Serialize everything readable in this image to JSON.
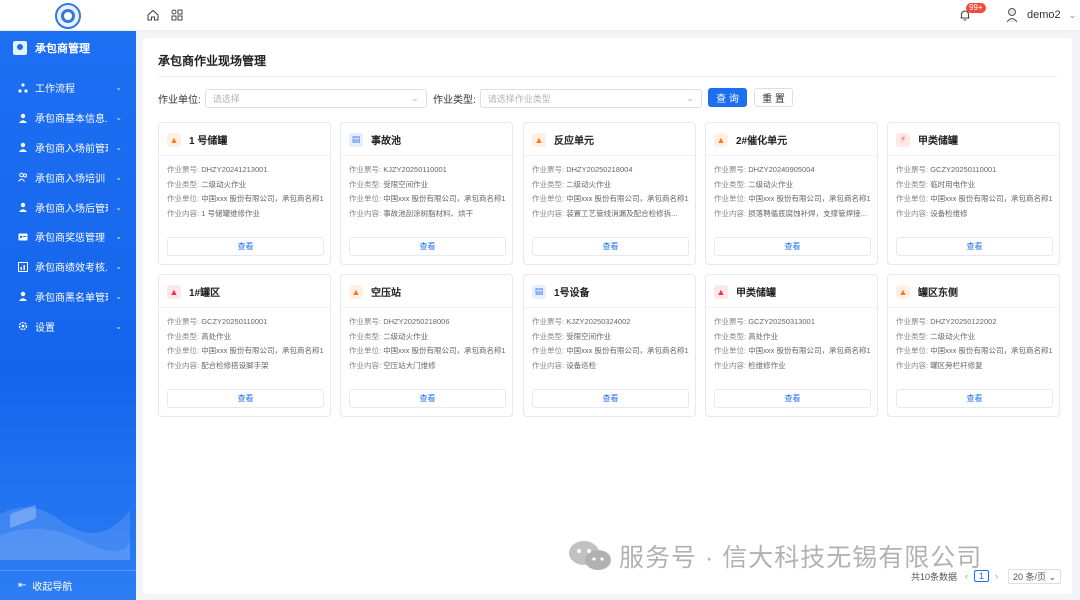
{
  "header": {
    "notification_badge": "99+",
    "user_name": "demo2"
  },
  "sidebar": {
    "header_label": "承包商管理",
    "items": [
      {
        "label": "工作流程",
        "icon": "workflow-icon"
      },
      {
        "label": "承包商基本信息...",
        "icon": "user-icon"
      },
      {
        "label": "承包商入场前管理",
        "icon": "user-icon"
      },
      {
        "label": "承包商入场培训",
        "icon": "users-icon"
      },
      {
        "label": "承包商入场后管理",
        "icon": "user-icon"
      },
      {
        "label": "承包商奖惩管理",
        "icon": "id-card-icon"
      },
      {
        "label": "承包商绩效考核...",
        "icon": "chart-icon"
      },
      {
        "label": "承包商黑名单管理",
        "icon": "user-icon"
      },
      {
        "label": "设置",
        "icon": "gear-icon"
      }
    ],
    "collapse_label": "收起导航"
  },
  "page": {
    "title": "承包商作业现场管理",
    "filters": {
      "unit_label": "作业单位:",
      "unit_placeholder": "请选择",
      "type_label": "作业类型:",
      "type_placeholder": "请选择作业类型"
    },
    "search_button": "查 询",
    "reset_button": "重 置"
  },
  "field_labels": {
    "ticket": "作业票号:",
    "type": "作业类型:",
    "unit": "作业单位:",
    "content": "作业内容:"
  },
  "view_label": "查看",
  "cards": [
    {
      "title": "1 号储罐",
      "icon": "fire",
      "ticket": "DHZY20241213001",
      "type": "二级动火作业",
      "unit": "中国xxx 股份有限公司，承包商名称1",
      "content": "1 号储罐维修作业"
    },
    {
      "title": "事故池",
      "icon": "doc",
      "ticket": "KJZY20250110001",
      "type": "受限空间作业",
      "unit": "中国xxx 股份有限公司，承包商名称1",
      "content": "事故池刮涂树脂材料、烘干"
    },
    {
      "title": "反应单元",
      "icon": "fire",
      "ticket": "DHZY20250218004",
      "type": "二级动火作业",
      "unit": "中国xxx 股份有限公司，承包商名称1",
      "content": "装置工艺管线消漏及配合检修拆..."
    },
    {
      "title": "2#催化单元",
      "icon": "fire",
      "ticket": "DHZY20240905004",
      "type": "二级动火作业",
      "unit": "中国xxx 股份有限公司，承包商名称1",
      "content": "损落聘循底腐蚀补焊，支撑管焊接..."
    },
    {
      "title": "甲类储罐",
      "icon": "elec",
      "ticket": "GCZY20250110001",
      "type": "临时用电作业",
      "unit": "中国xxx 股份有限公司，承包商名称1",
      "content": "设备检维修"
    },
    {
      "title": "1#罐区",
      "icon": "high",
      "ticket": "GCZY20250110001",
      "type": "高处作业",
      "unit": "中国xxx 股份有限公司，承包商名称1",
      "content": "配合检修搭设脚手架"
    },
    {
      "title": "空压站",
      "icon": "fire",
      "ticket": "DHZY20250218006",
      "type": "二级动火作业",
      "unit": "中国xxx 股份有限公司，承包商名称1",
      "content": "空压站大门维修"
    },
    {
      "title": "1号设备",
      "icon": "doc",
      "ticket": "KJZY20250324002",
      "type": "受限空间作业",
      "unit": "中国xxx 股份有限公司，承包商名称1",
      "content": "设备巡检"
    },
    {
      "title": "甲类储罐",
      "icon": "high",
      "ticket": "GCZY20250313001",
      "type": "高处作业",
      "unit": "中国xxx 股份有限公司，承包商名称1",
      "content": "检维修作业"
    },
    {
      "title": "罐区东侧",
      "icon": "fire",
      "ticket": "DHZY20250122002",
      "type": "二级动火作业",
      "unit": "中国xxx 股份有限公司，承包商名称1",
      "content": "罐区旁栏杆修复"
    }
  ],
  "pager": {
    "total": "共10条数据",
    "page": "1",
    "page_size": "20 条/页"
  },
  "watermark": "服务号 · 信大科技无锡有限公司"
}
